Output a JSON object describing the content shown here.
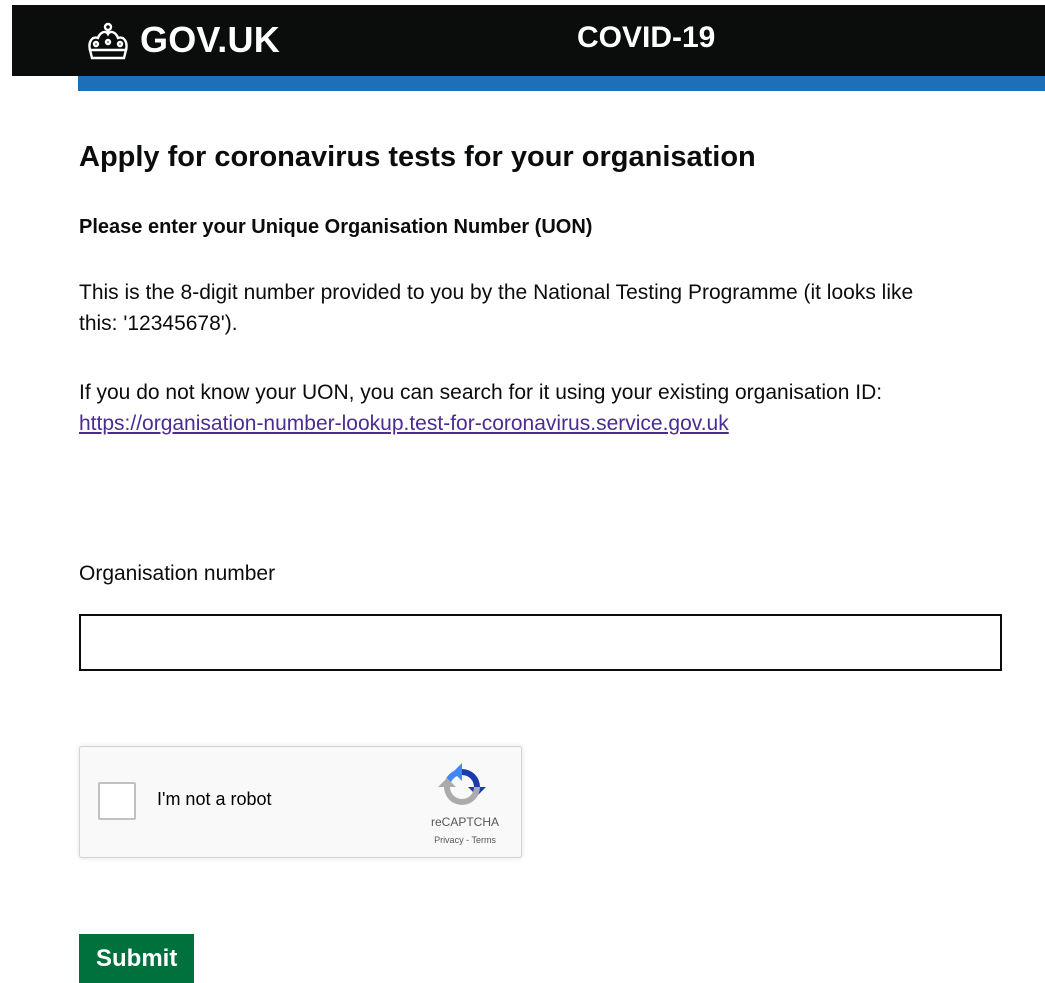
{
  "header": {
    "logo_text": "GOV.UK",
    "logo_icon": "crown-icon",
    "service_name": "COVID-19",
    "background_color": "#0b0c0c",
    "accent_color": "#1d70b8"
  },
  "main": {
    "title": "Apply for coronavirus tests for your organisation",
    "subheading": "Please enter your Unique Organisation Number (UON)",
    "paragraph1": "This is the 8-digit number provided to you by the National Testing Programme (it looks like this: '12345678').",
    "paragraph2_text": "If you do not know your UON, you can search for it using your existing organisation ID: ",
    "lookup_link": "https://organisation-number-lookup.test-for-coronavirus.service.gov.uk",
    "field_label": "Organisation number",
    "field_value": "",
    "recaptcha": {
      "label": "I'm not a robot",
      "brand": "reCAPTCHA",
      "privacy": "Privacy",
      "separator": "-",
      "terms": "Terms",
      "checked": false,
      "logo_icon": "recaptcha-icon"
    },
    "submit_label": "Submit",
    "submit_color": "#00703c",
    "link_color": "#4c2c92"
  }
}
